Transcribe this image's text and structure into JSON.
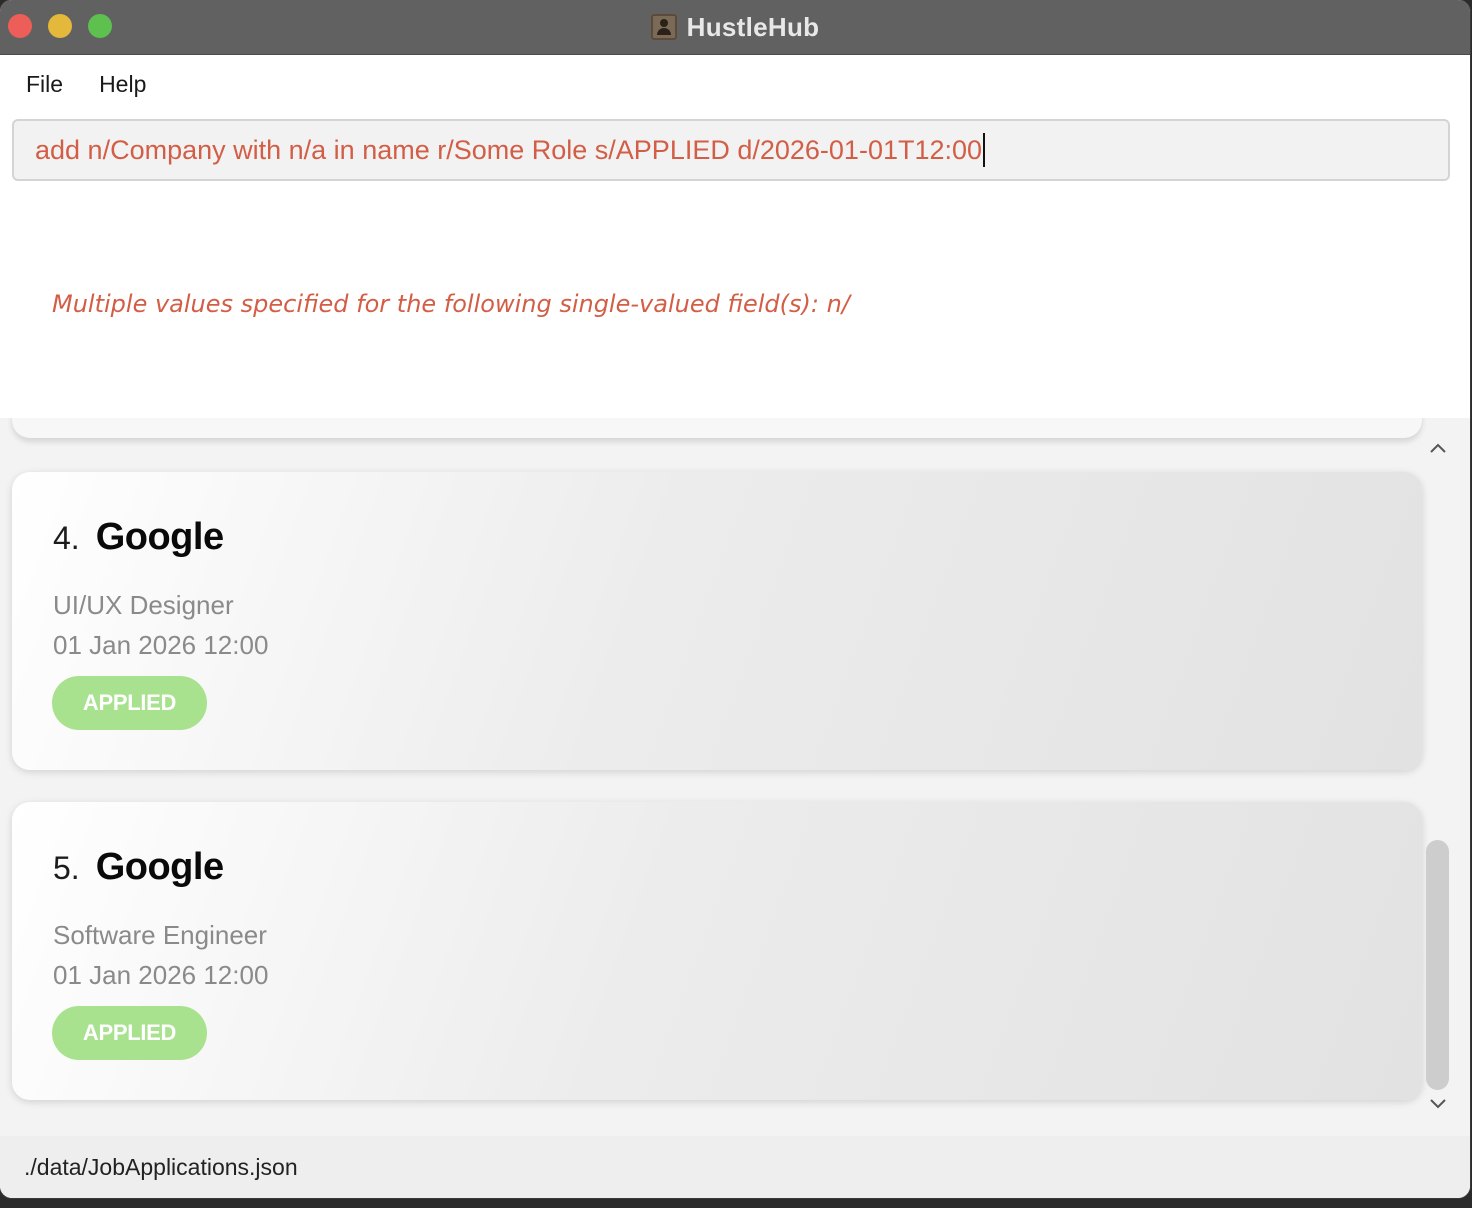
{
  "window": {
    "title": "HustleHub",
    "icon": "contacts-book-icon"
  },
  "menu": {
    "items": [
      {
        "label": "File"
      },
      {
        "label": "Help"
      }
    ]
  },
  "command": {
    "value": "add n/Company with n/a in name r/Some Role s/APPLIED d/2026-01-01T12:00"
  },
  "result": {
    "message": "Multiple values specified for the following single-valued field(s): n/"
  },
  "applications": [
    {
      "index": "4.",
      "company": "Google",
      "role": "UI/UX Designer",
      "date": "01 Jan 2026 12:00",
      "status": "APPLIED"
    },
    {
      "index": "5.",
      "company": "Google",
      "role": "Software Engineer",
      "date": "01 Jan 2026 12:00",
      "status": "APPLIED"
    }
  ],
  "statusbar": {
    "path": "./data/JobApplications.json"
  },
  "colors": {
    "error_text": "#d35e46",
    "status_applied": "#a9e28f",
    "titlebar": "#616161"
  }
}
